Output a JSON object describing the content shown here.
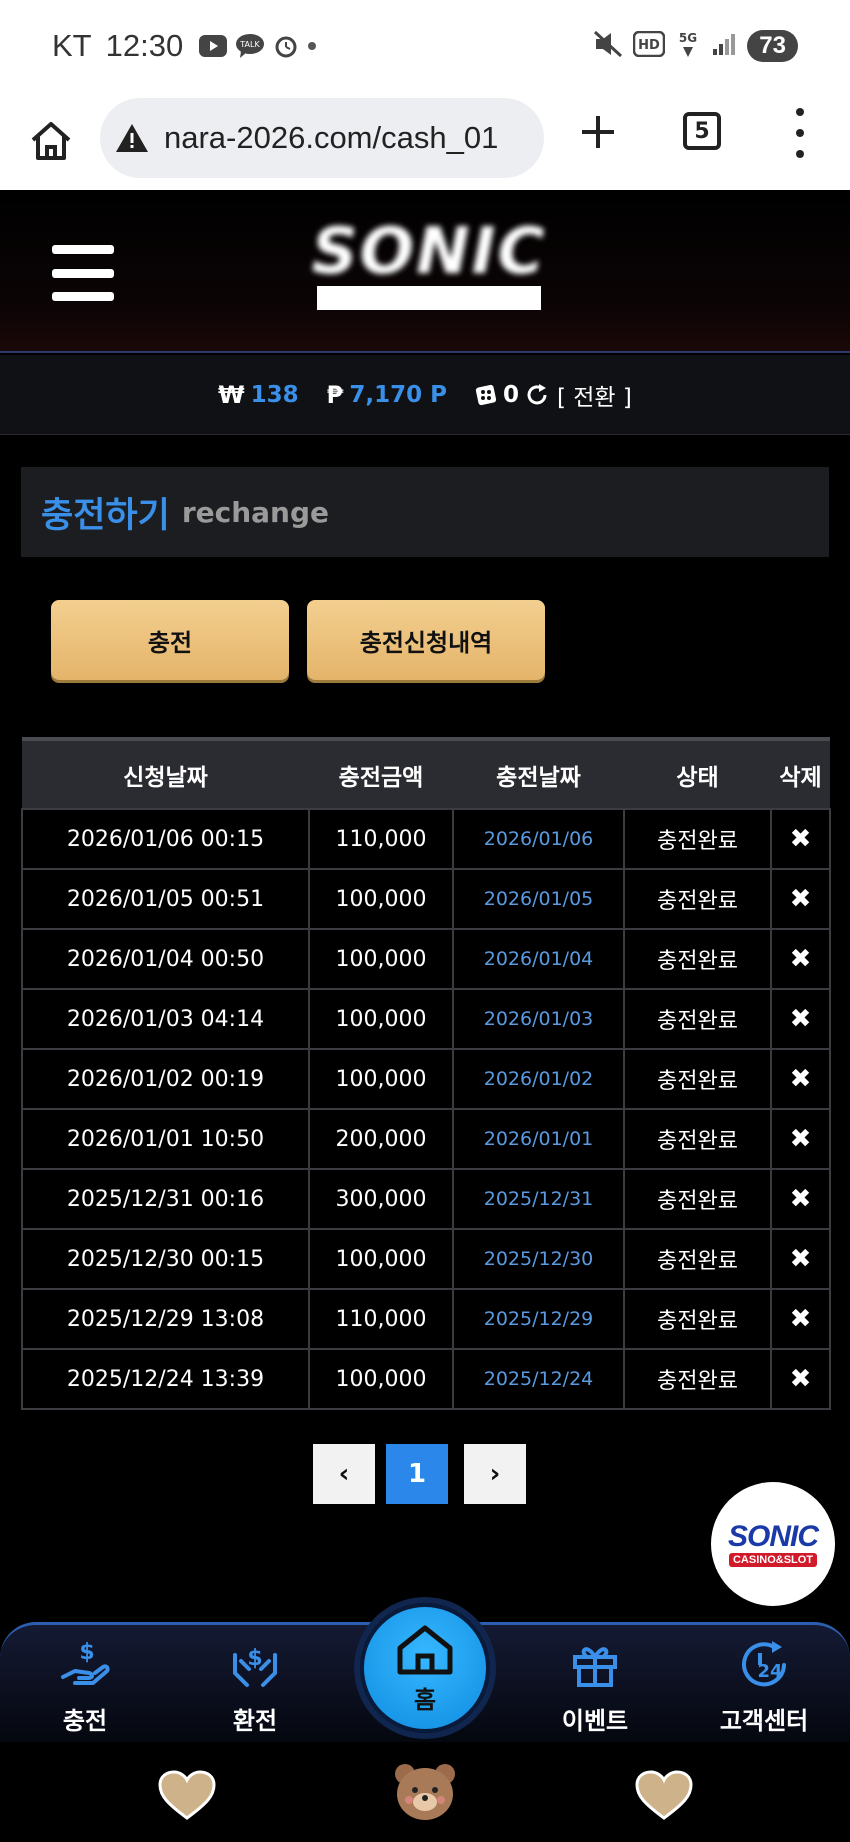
{
  "status_bar": {
    "carrier": "KT",
    "time": "12:30",
    "battery": "73"
  },
  "browser": {
    "url": "nara-2026.com/cash_01",
    "tab_count": "5"
  },
  "balance": {
    "won_symbol": "₩",
    "won_value": "138",
    "point_symbol": "₱",
    "point_value": "7,170 P",
    "chip_value": "0",
    "convert_label": "[ 전환 ]"
  },
  "section": {
    "title_ko": "충전하기",
    "title_en": "rechange"
  },
  "buttons": {
    "charge": "충전",
    "history": "충전신청내역"
  },
  "table": {
    "headers": [
      "신청날짜",
      "충전금액",
      "충전날짜",
      "상태",
      "삭제"
    ],
    "rows": [
      {
        "request_date": "2026/01/06 00:15",
        "amount": "110,000",
        "charge_date": "2026/01/06",
        "status": "충전완료",
        "delete": "✖"
      },
      {
        "request_date": "2026/01/05 00:51",
        "amount": "100,000",
        "charge_date": "2026/01/05",
        "status": "충전완료",
        "delete": "✖"
      },
      {
        "request_date": "2026/01/04 00:50",
        "amount": "100,000",
        "charge_date": "2026/01/04",
        "status": "충전완료",
        "delete": "✖"
      },
      {
        "request_date": "2026/01/03 04:14",
        "amount": "100,000",
        "charge_date": "2026/01/03",
        "status": "충전완료",
        "delete": "✖"
      },
      {
        "request_date": "2026/01/02 00:19",
        "amount": "100,000",
        "charge_date": "2026/01/02",
        "status": "충전완료",
        "delete": "✖"
      },
      {
        "request_date": "2026/01/01 10:50",
        "amount": "200,000",
        "charge_date": "2026/01/01",
        "status": "충전완료",
        "delete": "✖"
      },
      {
        "request_date": "2025/12/31 00:16",
        "amount": "300,000",
        "charge_date": "2025/12/31",
        "status": "충전완료",
        "delete": "✖"
      },
      {
        "request_date": "2025/12/30 00:15",
        "amount": "100,000",
        "charge_date": "2025/12/30",
        "status": "충전완료",
        "delete": "✖"
      },
      {
        "request_date": "2025/12/29 13:08",
        "amount": "110,000",
        "charge_date": "2025/12/29",
        "status": "충전완료",
        "delete": "✖"
      },
      {
        "request_date": "2025/12/24 13:39",
        "amount": "100,000",
        "charge_date": "2025/12/24",
        "status": "충전완료",
        "delete": "✖"
      }
    ]
  },
  "pagination": {
    "prev": "‹",
    "current": "1",
    "next": "›"
  },
  "badge": {
    "name": "SONIC",
    "sub": "CASINO&SLOT"
  },
  "bottom_nav": {
    "charge": "충전",
    "exchange": "환전",
    "home": "홈",
    "event": "이벤트",
    "support": "고객센터"
  },
  "colors": {
    "accent_blue": "#3a8fe8",
    "gold_button": "#e9bd73",
    "pager_active": "#2b88ea"
  }
}
